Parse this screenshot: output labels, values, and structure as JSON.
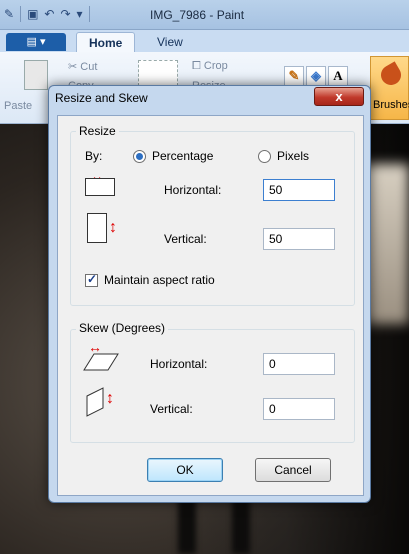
{
  "app": {
    "window_title": "IMG_7986 - Paint",
    "tabs": [
      "Home",
      "View"
    ],
    "ribbon": {
      "cut_label": "Cut",
      "copy_label": "Copy",
      "crop_label": "Crop",
      "resize_label": "Resize",
      "paste_label": "Paste",
      "brushes_label": "Brushes"
    }
  },
  "dialog": {
    "title": "Resize and Skew",
    "close_label": "x",
    "resize": {
      "group_label": "Resize",
      "by_label": "By:",
      "percentage_label": "Percentage",
      "pixels_label": "Pixels",
      "selected_unit": "Percentage",
      "horizontal_label": "Horizontal:",
      "horizontal_value": "50",
      "vertical_label": "Vertical:",
      "vertical_value": "50",
      "maintain_label": "Maintain aspect ratio",
      "maintain_checked": true
    },
    "skew": {
      "group_label": "Skew (Degrees)",
      "horizontal_label": "Horizontal:",
      "horizontal_value": "0",
      "vertical_label": "Vertical:",
      "vertical_value": "0"
    },
    "ok_label": "OK",
    "cancel_label": "Cancel"
  },
  "colors": {
    "accent": "#3c7fd0",
    "arrow": "#dd0000",
    "close": "#c0392b"
  }
}
